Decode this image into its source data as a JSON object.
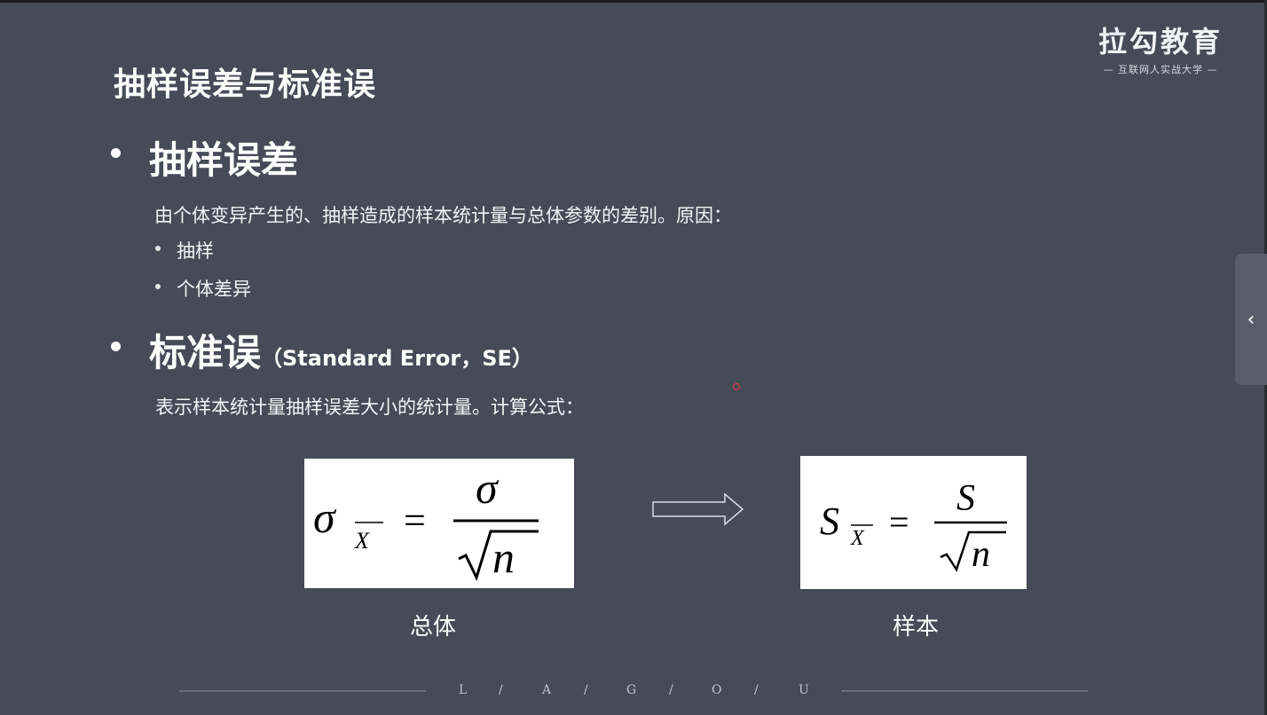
{
  "brand": {
    "logo_text": "拉勾教育",
    "tagline": "— 互联网人实战大学 —"
  },
  "slide": {
    "title": "抽样误差与标准误",
    "section1": {
      "heading": "抽样误差",
      "description": "由个体变异产生的、抽样造成的样本统计量与总体参数的差别。原因：",
      "items": [
        "抽样",
        "个体差异"
      ]
    },
    "section2": {
      "heading": "标准误",
      "heading_paren": "（Standard Error，SE）",
      "description": "表示样本统计量抽样误差大小的统计量。计算公式："
    },
    "formulas": {
      "population_caption": "总体",
      "sample_caption": "样本",
      "population_lhs": "σ",
      "population_num": "σ",
      "sample_lhs": "S",
      "sample_num": "S",
      "subscript": "X",
      "radicand": "n",
      "equals": "="
    }
  },
  "footer": {
    "letters": [
      "L",
      "/",
      "A",
      "/",
      "G",
      "/",
      "O",
      "/",
      "U"
    ]
  },
  "side_panel": {
    "icon": "chevron-left-icon",
    "glyph": "‹"
  },
  "colors": {
    "background": "#474a57",
    "text": "#ffffff",
    "formula_bg": "#ffffff",
    "pointer_dot": "#e0383d"
  }
}
